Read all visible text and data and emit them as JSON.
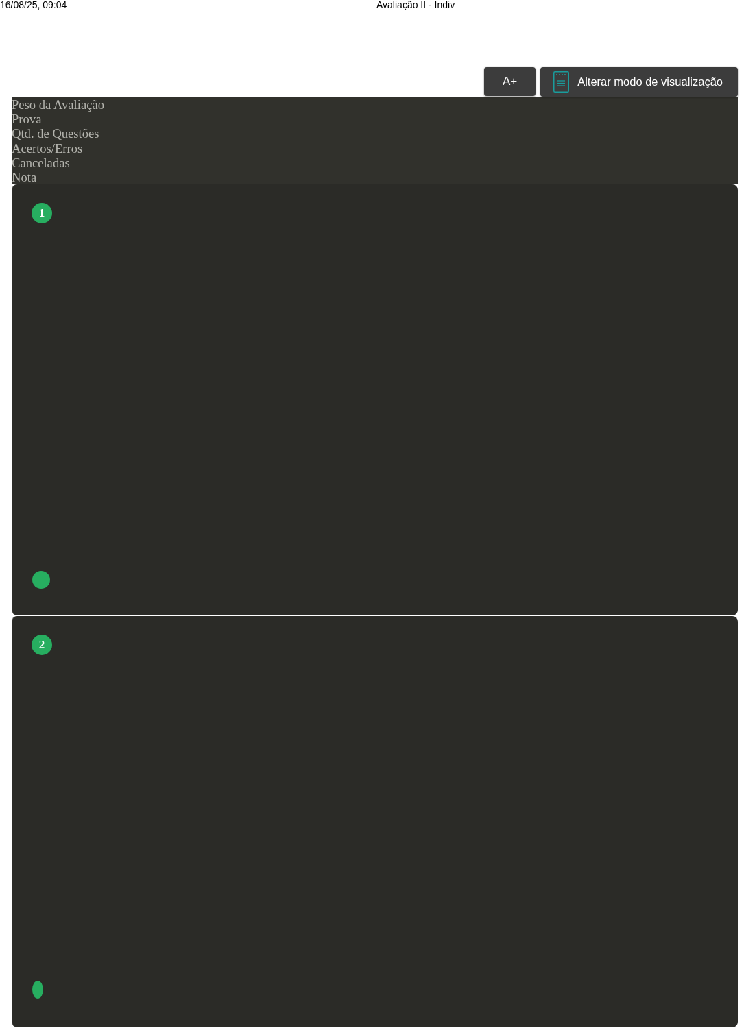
{
  "header": {
    "date": "16/08/25, 09:04",
    "title": "Avaliação II - Indiv"
  },
  "toolbar": {
    "buttons": [
      {
        "kind": "text",
        "label": "A+"
      },
      {
        "kind": "icon_text",
        "label": "Alterar modo de visualização"
      }
    ]
  },
  "summary": {
    "labels": [
      "Peso da Avaliação",
      "Prova",
      "Qtd. de Questões",
      "Acertos/Erros",
      "Canceladas",
      "Nota"
    ]
  },
  "questions": [
    {
      "number": "1",
      "kind": "circle"
    },
    {
      "number": "2",
      "kind": "oval"
    }
  ]
}
